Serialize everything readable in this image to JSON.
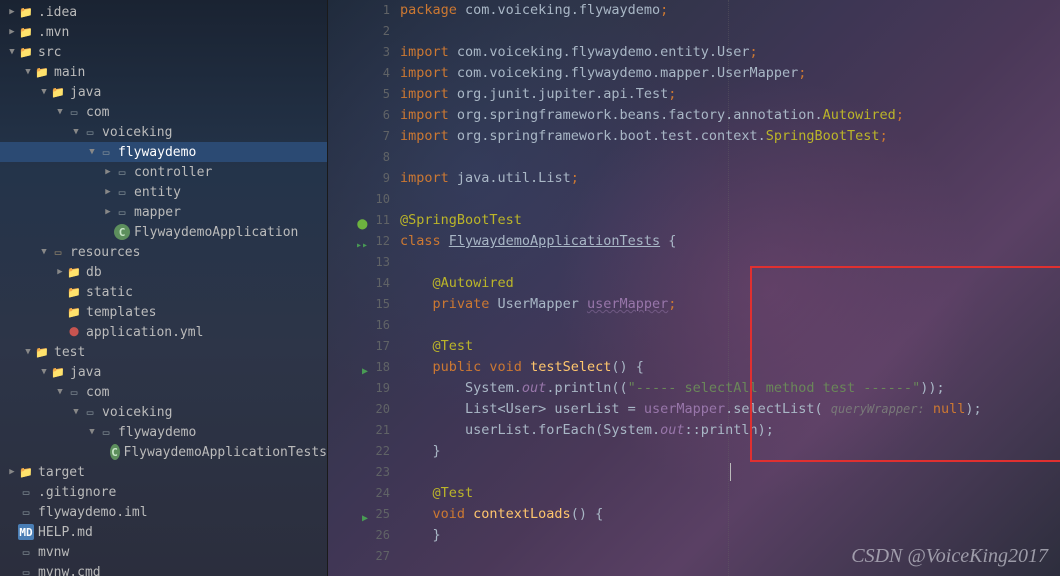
{
  "watermark": "CSDN @VoiceKing2017",
  "tree": [
    {
      "depth": 0,
      "arrow": "▶",
      "icon": "folder",
      "label": ".idea"
    },
    {
      "depth": 0,
      "arrow": "▶",
      "icon": "folder",
      "label": ".mvn"
    },
    {
      "depth": 0,
      "arrow": "▼",
      "icon": "src-folder",
      "label": "src"
    },
    {
      "depth": 1,
      "arrow": "▼",
      "icon": "folder",
      "label": "main"
    },
    {
      "depth": 2,
      "arrow": "▼",
      "icon": "java-folder",
      "label": "java"
    },
    {
      "depth": 3,
      "arrow": "▼",
      "icon": "pkg",
      "label": "com"
    },
    {
      "depth": 4,
      "arrow": "▼",
      "icon": "pkg",
      "label": "voiceking"
    },
    {
      "depth": 5,
      "arrow": "▼",
      "icon": "pkg",
      "label": "flywaydemo",
      "selected": true
    },
    {
      "depth": 6,
      "arrow": "▶",
      "icon": "pkg",
      "label": "controller"
    },
    {
      "depth": 6,
      "arrow": "▶",
      "icon": "pkg",
      "label": "entity"
    },
    {
      "depth": 6,
      "arrow": "▶",
      "icon": "pkg",
      "label": "mapper"
    },
    {
      "depth": 6,
      "arrow": "",
      "icon": "class",
      "label": "FlywaydemoApplication"
    },
    {
      "depth": 2,
      "arrow": "▼",
      "icon": "re-folder",
      "label": "resources"
    },
    {
      "depth": 3,
      "arrow": "▶",
      "icon": "folder",
      "label": "db"
    },
    {
      "depth": 3,
      "arrow": "",
      "icon": "folder",
      "label": "static"
    },
    {
      "depth": 3,
      "arrow": "",
      "icon": "folder",
      "label": "templates"
    },
    {
      "depth": 3,
      "arrow": "",
      "icon": "yml",
      "label": "application.yml"
    },
    {
      "depth": 1,
      "arrow": "▼",
      "icon": "folder",
      "label": "test"
    },
    {
      "depth": 2,
      "arrow": "▼",
      "icon": "java-folder-green",
      "label": "java"
    },
    {
      "depth": 3,
      "arrow": "▼",
      "icon": "pkg",
      "label": "com"
    },
    {
      "depth": 4,
      "arrow": "▼",
      "icon": "pkg",
      "label": "voiceking"
    },
    {
      "depth": 5,
      "arrow": "▼",
      "icon": "pkg",
      "label": "flywaydemo"
    },
    {
      "depth": 6,
      "arrow": "",
      "icon": "class",
      "label": "FlywaydemoApplicationTests"
    },
    {
      "depth": 0,
      "arrow": "▶",
      "icon": "excluded",
      "label": "target"
    },
    {
      "depth": 0,
      "arrow": "",
      "icon": "file",
      "label": ".gitignore"
    },
    {
      "depth": 0,
      "arrow": "",
      "icon": "file",
      "label": "flywaydemo.iml"
    },
    {
      "depth": 0,
      "arrow": "",
      "icon": "md",
      "label": "HELP.md"
    },
    {
      "depth": 0,
      "arrow": "",
      "icon": "file",
      "label": "mvnw"
    },
    {
      "depth": 0,
      "arrow": "",
      "icon": "file",
      "label": "mvnw.cmd"
    }
  ],
  "lines": {
    "numbers": [
      "1",
      "2",
      "3",
      "4",
      "5",
      "6",
      "7",
      "8",
      "9",
      "10",
      "11",
      "12",
      "13",
      "14",
      "15",
      "16",
      "17",
      "18",
      "19",
      "20",
      "21",
      "22",
      "23",
      "24",
      "25",
      "26",
      "27"
    ],
    "l1_kw": "package",
    "l1_pkg": " com.voiceking.flywaydemo",
    "semi": ";",
    "l3_kw": "import",
    "l3_pkg": " com.voiceking.flywaydemo.entity.User",
    "l4_pkg": " com.voiceking.flywaydemo.mapper.UserMapper",
    "l5_pkg": " org.junit.jupiter.api.Test",
    "l6_pkg": " org.springframework.beans.factory.annotation.",
    "l6_anno": "Autowired",
    "l7_pkg": " org.springframework.boot.test.context.",
    "l7_anno": "SpringBootTest",
    "l9_pkg": " java.util.List",
    "l11_anno": "@SpringBootTest",
    "l12_kw": "class ",
    "l12_class": "FlywaydemoApplicationTests",
    "l12_brace": " {",
    "l14_anno": "@Autowired",
    "l15_kw": "private ",
    "l15_type": "UserMapper ",
    "l15_field": "userMapper",
    "l17_anno": "@Test",
    "l18_mod": "public void ",
    "l18_method": "testSelect",
    "l18_sig": "() {",
    "l19_pre": "    System.",
    "l19_out": "out",
    "l19_printcall": ".println((",
    "l19_str": "\"----- selectAll method test ------\"",
    "l19_end": "));",
    "l20_pre": "    List<User> userList = ",
    "l20_mapper": "userMapper",
    "l20_call": ".selectList( ",
    "l20_hint": "queryWrapper:",
    "l20_null": " null",
    "l20_end": ");",
    "l21_pre": "    userList.forEach(System.",
    "l21_out": "out",
    "l21_rest": "::println);",
    "l22_brace": "}",
    "l24_anno": "@Test",
    "l25_kw": "void ",
    "l25_method": "contextLoads",
    "l25_sig": "() {",
    "l26_brace": "}"
  }
}
